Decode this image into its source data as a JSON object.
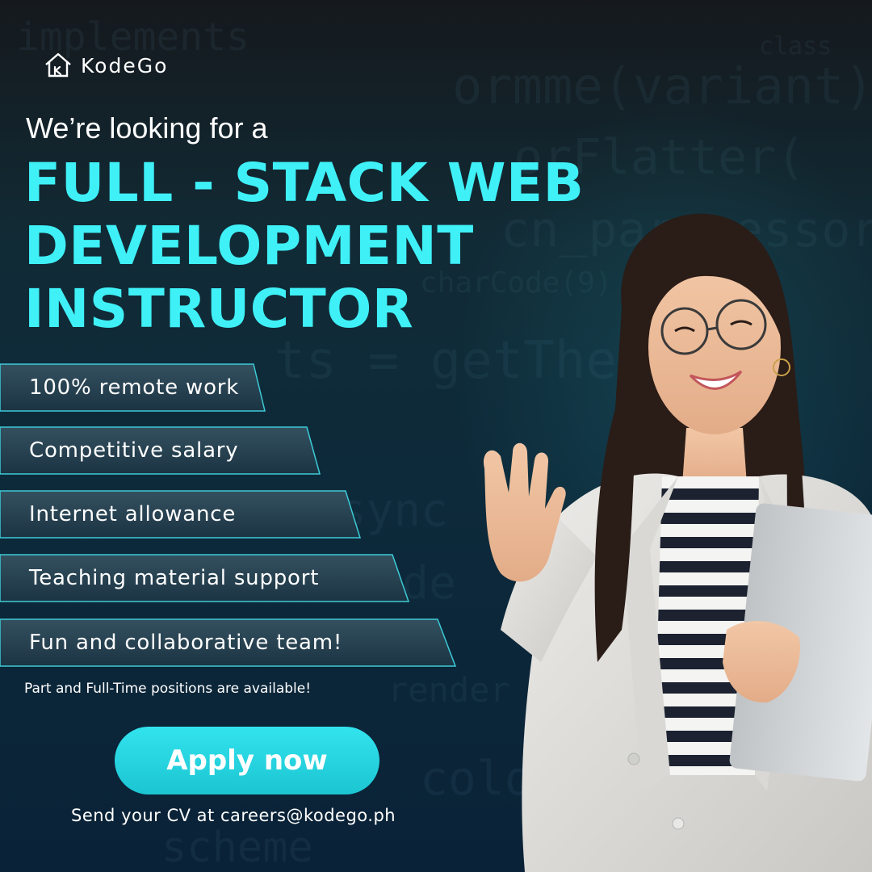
{
  "brand": {
    "name": "KodeGo",
    "icon": "kodego-house-icon"
  },
  "intro": "We’re looking for a",
  "headline": [
    "FULL - STACK WEB",
    "DEVELOPMENT",
    "INSTRUCTOR"
  ],
  "perks": [
    "100% remote work",
    "Competitive salary",
    "Internet allowance",
    "Teaching material support",
    "Fun and collaborative team!"
  ],
  "note": "Part and Full-Time positions are available!",
  "cta": {
    "label": "Apply now"
  },
  "cv_text": "Send your CV at careers@kodego.ph",
  "colors": {
    "accent": "#3ff0f7",
    "button": "#22cdd9",
    "background": "#0d2a3a"
  }
}
